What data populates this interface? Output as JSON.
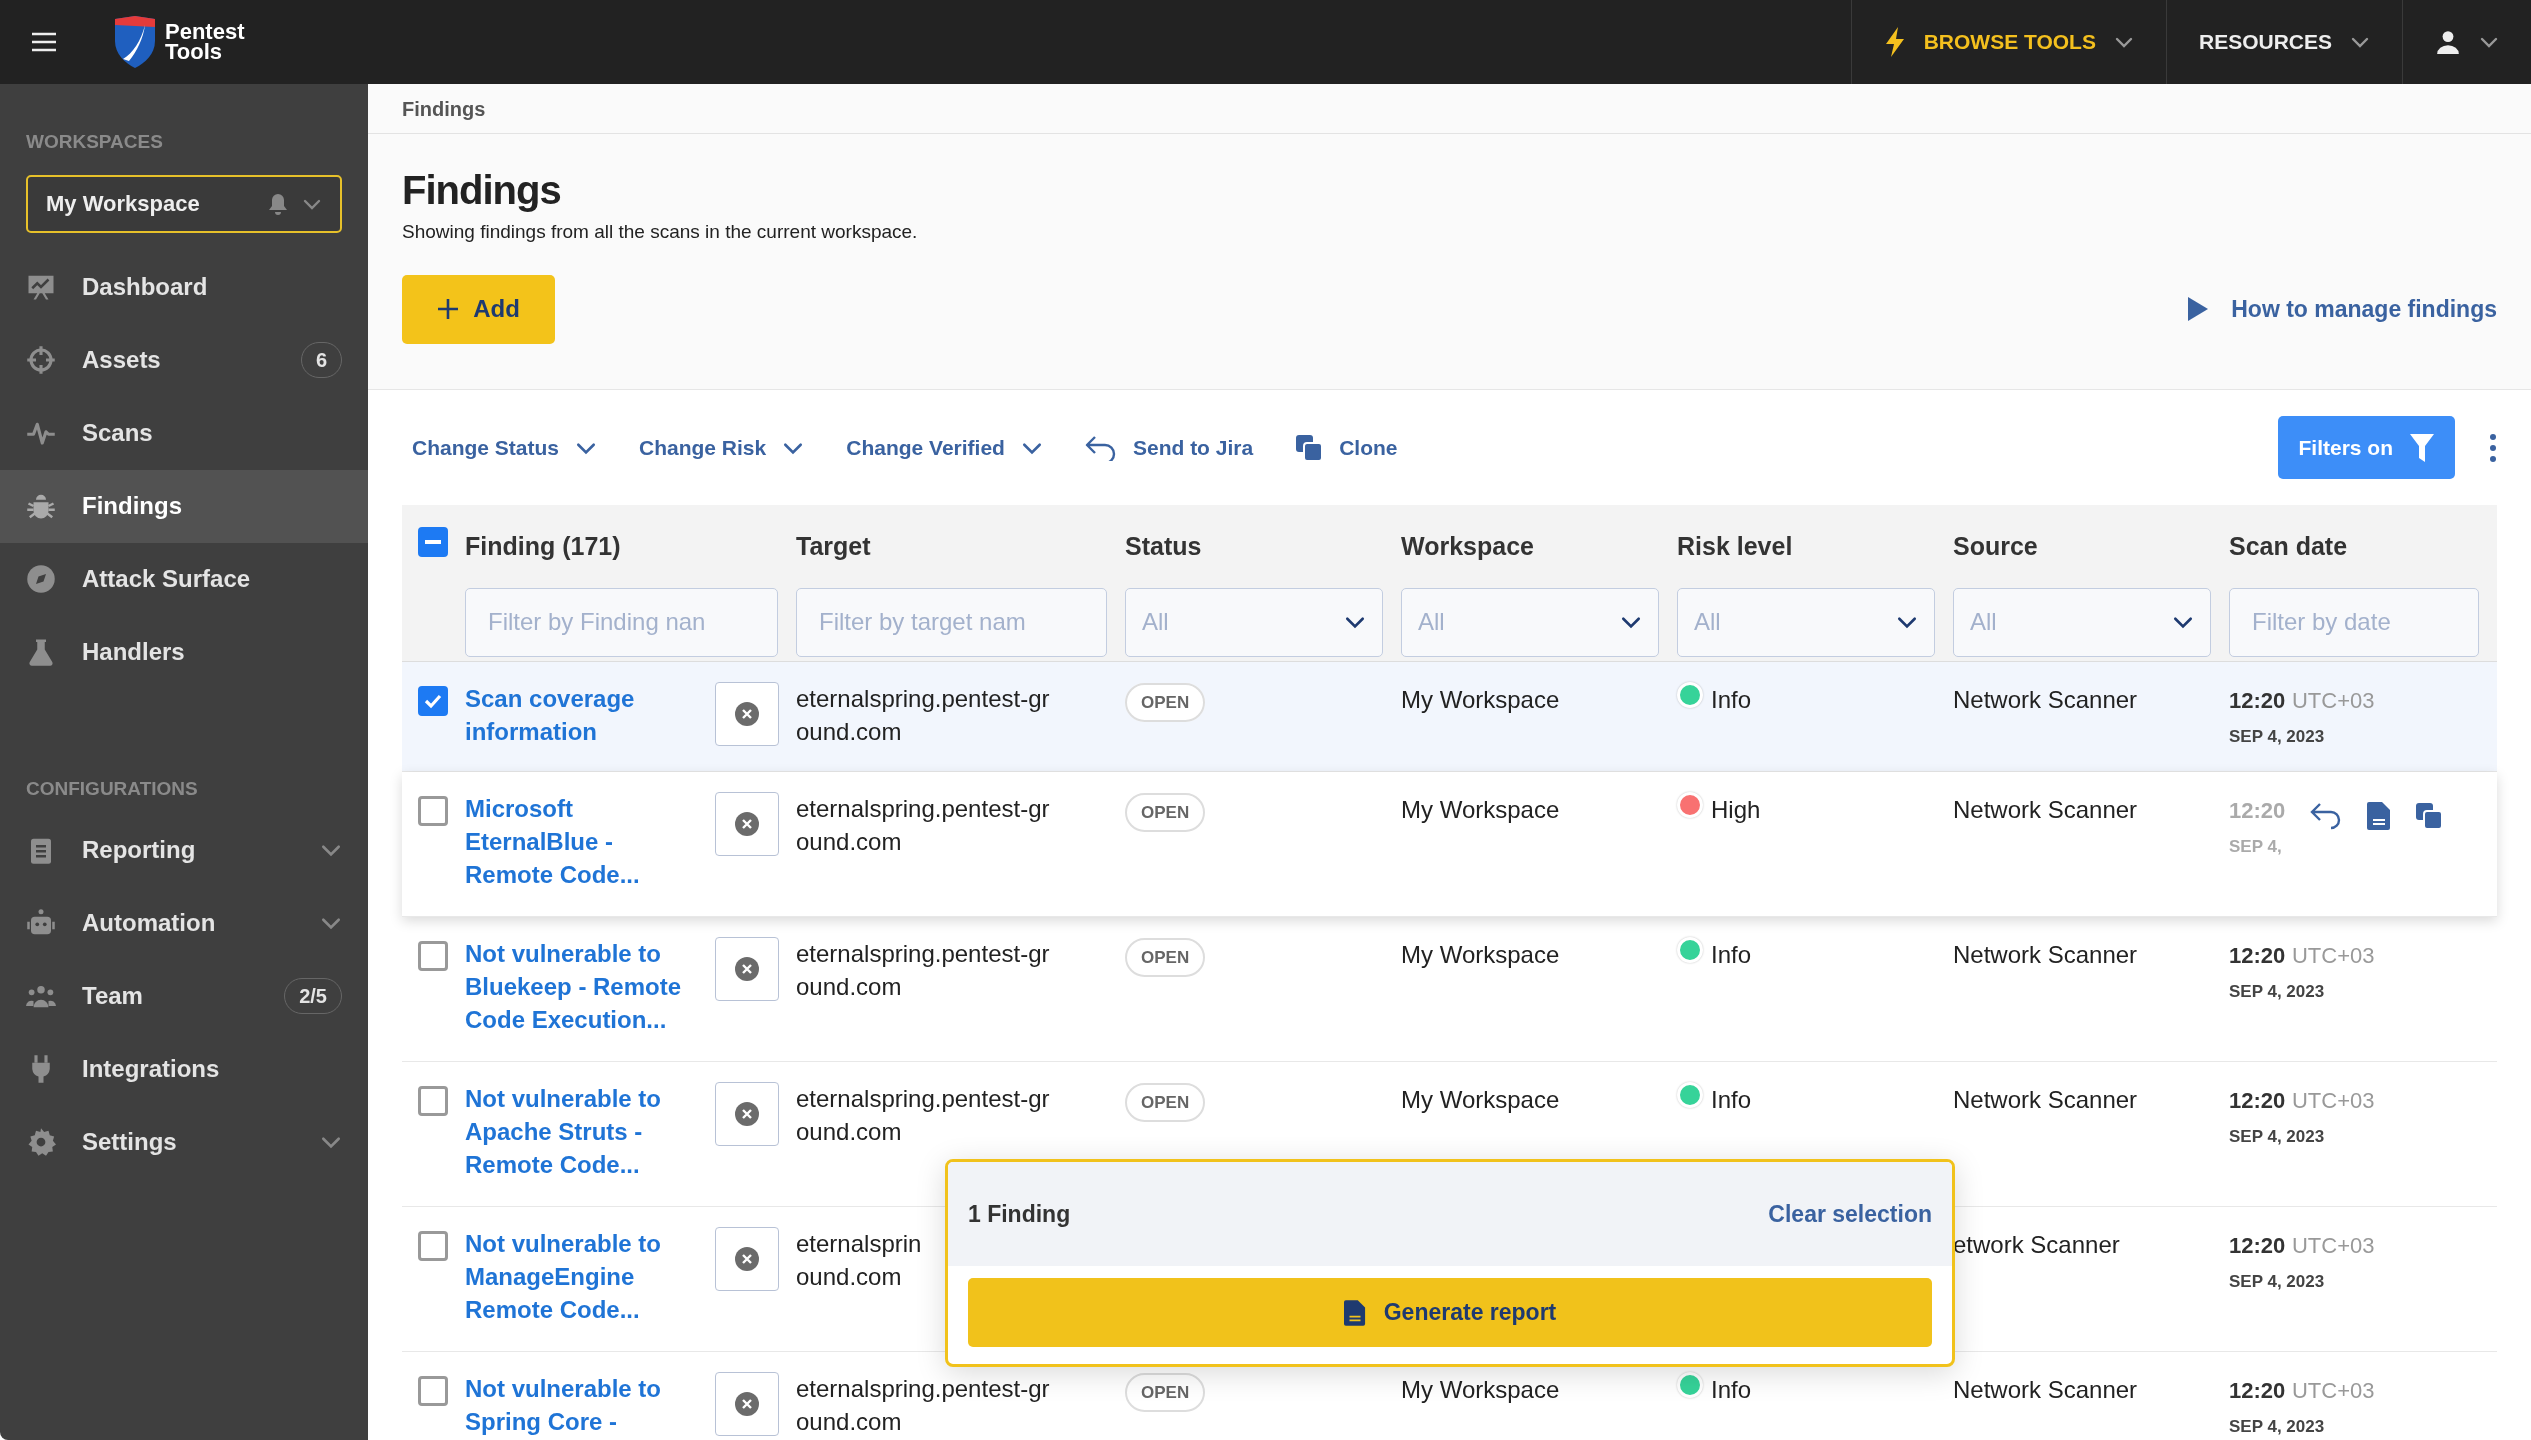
{
  "topbar": {
    "logo_lines": [
      "Pentest",
      "Tools"
    ],
    "menus": [
      {
        "label": "BROWSE TOOLS",
        "kind": "highlight"
      },
      {
        "label": "RESOURCES",
        "kind": "plain"
      }
    ]
  },
  "sidebar": {
    "workspaces_label": "WORKSPACES",
    "workspace": "My Workspace",
    "nav": [
      {
        "label": "Dashboard",
        "selected": false,
        "has_submenu": false
      },
      {
        "label": "Assets",
        "badge": "6",
        "selected": false,
        "has_submenu": false
      },
      {
        "label": "Scans",
        "selected": false,
        "has_submenu": false
      },
      {
        "label": "Findings",
        "selected": true,
        "has_submenu": false
      },
      {
        "label": "Attack Surface",
        "selected": false,
        "has_submenu": false
      },
      {
        "label": "Handlers",
        "selected": false,
        "has_submenu": false
      }
    ],
    "config_label": "CONFIGURATIONS",
    "config": [
      {
        "label": "Reporting",
        "selected": false,
        "has_submenu": true
      },
      {
        "label": "Automation",
        "selected": false,
        "has_submenu": true
      },
      {
        "label": "Team",
        "badge": "2/5",
        "selected": false,
        "has_submenu": false
      },
      {
        "label": "Integrations",
        "selected": false,
        "has_submenu": false
      },
      {
        "label": "Settings",
        "selected": false,
        "has_submenu": true
      }
    ]
  },
  "breadcrumb": "Findings",
  "page": {
    "title": "Findings",
    "subtitle": "Showing findings from all the scans in the current workspace.",
    "add_button": "Add",
    "help_link": "How to manage findings"
  },
  "toolbar": {
    "actions": [
      {
        "label": "Change Status",
        "kind": "dropdown"
      },
      {
        "label": "Change Risk",
        "kind": "dropdown"
      },
      {
        "label": "Change Verified",
        "kind": "dropdown"
      },
      {
        "label": "Send to Jira",
        "kind": "send"
      },
      {
        "label": "Clone",
        "kind": "clone"
      }
    ],
    "filters_button": "Filters on"
  },
  "table": {
    "header_checkbox": {
      "indeterminate": true
    },
    "columns": [
      {
        "label": "Finding (171)",
        "filter": {
          "kind": "text",
          "placeholder": "Filter by Finding nan"
        }
      },
      {
        "label": "Target",
        "filter": {
          "kind": "text",
          "placeholder": "Filter by target nam"
        }
      },
      {
        "label": "Status",
        "filter": {
          "kind": "select",
          "value": "All"
        }
      },
      {
        "label": "Workspace",
        "filter": {
          "kind": "select",
          "value": "All"
        }
      },
      {
        "label": "Risk level",
        "filter": {
          "kind": "select",
          "value": "All"
        }
      },
      {
        "label": "Source",
        "filter": {
          "kind": "select",
          "value": "All"
        }
      },
      {
        "label": "Scan date",
        "filter": {
          "kind": "text",
          "placeholder": "Filter by date"
        }
      }
    ],
    "rows": [
      {
        "finding": "Scan coverage information",
        "selected": true,
        "hovered": false,
        "target": [
          "eternalspring.pentest-gr",
          "ound.com"
        ],
        "status": "OPEN",
        "workspace": "My Workspace",
        "risk": {
          "label": "Info",
          "color": "#36d399"
        },
        "source": "Network Scanner",
        "time": "12:20",
        "tz": "UTC+03",
        "date": "SEP 4, 2023"
      },
      {
        "finding": "Microsoft EternalBlue - Remote Code...",
        "selected": false,
        "hovered": true,
        "target": [
          "eternalspring.pentest-gr",
          "ound.com"
        ],
        "status": "OPEN",
        "workspace": "My Workspace",
        "risk": {
          "label": "High",
          "color": "#f87171"
        },
        "source": "Network Scanner",
        "time": "12:20",
        "date": "SEP 4,"
      },
      {
        "finding": "Not vulnerable to Bluekeep - Remote Code Execution...",
        "selected": false,
        "hovered": false,
        "target": [
          "eternalspring.pentest-gr",
          "ound.com"
        ],
        "status": "OPEN",
        "workspace": "My Workspace",
        "risk": {
          "label": "Info",
          "color": "#36d399"
        },
        "source": "Network Scanner",
        "time": "12:20",
        "tz": "UTC+03",
        "date": "SEP 4, 2023"
      },
      {
        "finding": "Not vulnerable to Apache Struts - Remote Code...",
        "selected": false,
        "hovered": false,
        "target": [
          "eternalspring.pentest-gr",
          "ound.com"
        ],
        "status": "OPEN",
        "workspace": "My Workspace",
        "risk": {
          "label": "Info",
          "color": "#36d399"
        },
        "source": "Network Scanner",
        "time": "12:20",
        "tz": "UTC+03",
        "date": "SEP 4, 2023"
      },
      {
        "finding": "Not vulnerable to ManageEngine Remote Code...",
        "selected": false,
        "hovered": false,
        "target": [
          "eternalsprin",
          "ound.com"
        ],
        "source": "etwork Scanner",
        "time": "12:20",
        "tz": "UTC+03",
        "date": "SEP 4, 2023"
      },
      {
        "finding": "Not vulnerable to Spring Core -",
        "selected": false,
        "hovered": false,
        "target": [
          "eternalspring.pentest-gr",
          "ound.com"
        ],
        "status": "OPEN",
        "workspace": "My Workspace",
        "risk": {
          "label": "Info",
          "color": "#36d399"
        },
        "source": "Network Scanner",
        "time": "12:20",
        "tz": "UTC+03",
        "date": "SEP 4, 2023"
      }
    ]
  },
  "selection_panel": {
    "count": "1 Finding",
    "clear": "Clear selection",
    "generate": "Generate report"
  }
}
